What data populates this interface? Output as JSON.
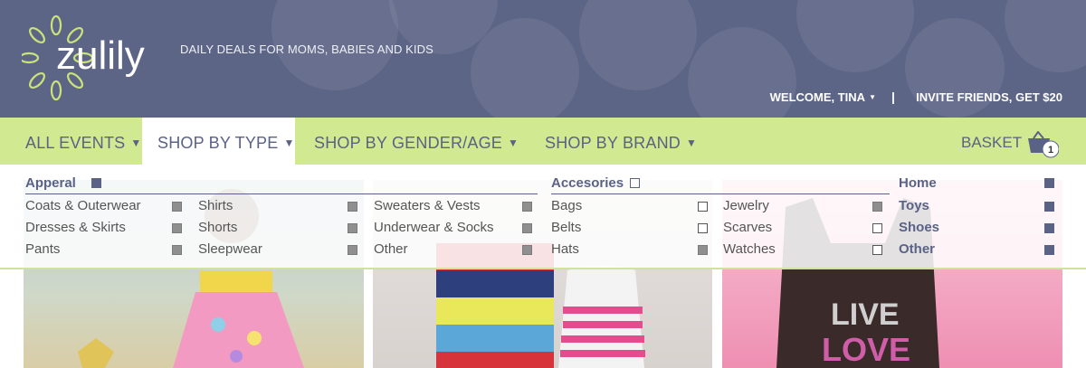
{
  "header": {
    "brand": "zulily",
    "tagline": "DAILY DEALS FOR MOMS, BABIES AND KIDS",
    "welcome": "WELCOME, TINA",
    "separator": "|",
    "invite": "INVITE FRIENDS, GET $20"
  },
  "nav": {
    "items": [
      {
        "label": "ALL EVENTS"
      },
      {
        "label": "SHOP BY TYPE"
      },
      {
        "label": "SHOP BY GENDER/AGE"
      },
      {
        "label": "SHOP BY BRAND"
      }
    ],
    "basket_label": "BASKET",
    "basket_count": "1"
  },
  "dropdown": {
    "apparel": {
      "heading": "Apperal",
      "items": [
        "Coats & Outerwear",
        "Dresses & Skirts",
        "Pants",
        "Shirts",
        "Shorts",
        "Sleepwear",
        "Sweaters & Vests",
        "Underwear & Socks",
        "Other"
      ]
    },
    "accessories": {
      "heading": "Accesories",
      "items": [
        "Bags",
        "Belts",
        "Hats",
        "Jewelry",
        "Scarves",
        "Watches"
      ]
    },
    "other": {
      "items": [
        "Home",
        "Toys",
        "Shoes",
        "Other"
      ]
    }
  },
  "products": {
    "tee_text": [
      "LIVE",
      "LOVE"
    ]
  },
  "colors": {
    "header_bg": "#5d6587",
    "nav_bg": "#d1e991",
    "accent_navy": "#5a6286",
    "logo_green": "#c9e27a"
  }
}
